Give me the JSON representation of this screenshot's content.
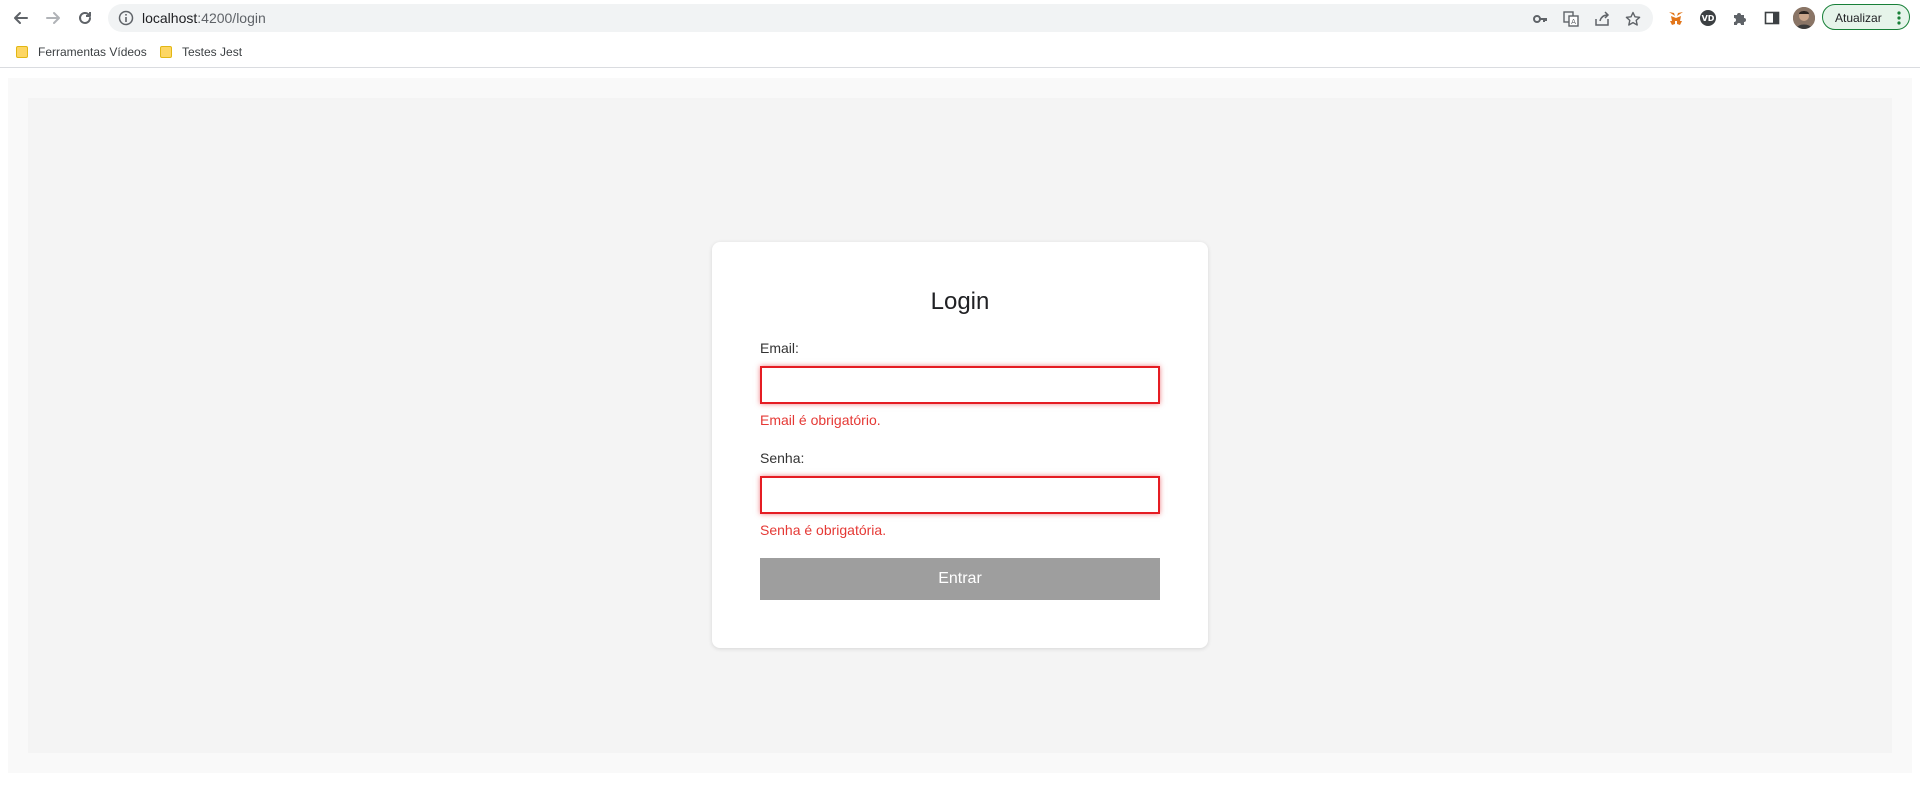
{
  "browser": {
    "url_host": "localhost",
    "url_path": ":4200/login",
    "update_label": "Atualizar"
  },
  "bookmarks": [
    {
      "label": "Ferramentas Vídeos"
    },
    {
      "label": "Testes Jest"
    }
  ],
  "login": {
    "title": "Login",
    "email_label": "Email:",
    "email_value": "",
    "email_error": "Email é obrigatório.",
    "password_label": "Senha:",
    "password_value": "",
    "password_error": "Senha é obrigatória.",
    "submit_label": "Entrar"
  },
  "icons": [
    "back-arrow-icon",
    "forward-arrow-icon",
    "reload-icon",
    "info-icon",
    "key-icon",
    "translate-icon",
    "share-icon",
    "star-icon",
    "metamask-icon",
    "vd-extension-icon",
    "puzzle-icon",
    "side-panel-icon",
    "folder-icon",
    "more-vert-icon"
  ],
  "colors": {
    "error": "#e53935",
    "input_border_error": "#e51c23",
    "button_disabled": "#9e9e9e",
    "update_button_border": "#188038"
  }
}
